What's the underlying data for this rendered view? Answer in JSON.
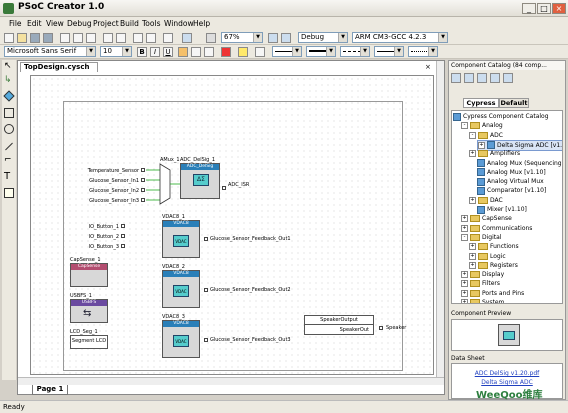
{
  "window": {
    "title": "PSoC Creator 1.0"
  },
  "menu": [
    "File",
    "Edit",
    "View",
    "Debug",
    "Project",
    "Build",
    "Tools",
    "Window",
    "Help"
  ],
  "toolbar": {
    "zoom": "67%",
    "configuration": "Debug",
    "compiler": "ARM CM3-GCC 4.2.3",
    "font": "Microsoft Sans Serif",
    "font_size": "10"
  },
  "document": {
    "tab": "TopDesign.cysch",
    "page_tab": "Page 1"
  },
  "schematic": {
    "adc_inputs": [
      "Temperature_Sensor",
      "Glucose_Sensor_In1",
      "Glucose_Sensor_In2",
      "Glucose_Sensor_In3"
    ],
    "amux_label": "AMux_1",
    "adc_label": "ADC_DelSig_1",
    "adc_type": "ADC_DelSig",
    "adc_isr": "ADC_ISR",
    "io_buttons": [
      "IO_Button_1",
      "IO_Button_2",
      "IO_Button_3"
    ],
    "vdac_labels": [
      "VDAC8_1",
      "VDAC8_2",
      "VDAC8_3"
    ],
    "vdac_type": "VDAC8",
    "vdac_outputs": [
      "Glucose_Sensor_Feedback_Out1",
      "Glucose_Sensor_Feedback_Out2",
      "Glucose_Sensor_Feedback_Out3"
    ],
    "capsense_label": "CapSense_1",
    "capsense_type": "CapSense",
    "usbfs_label": "USBFS_1",
    "usbfs_type": "USBFS",
    "lcd_label": "LCD_Seg_1",
    "lcd_type": "Segment LCD",
    "speaker_box": "SpeakerOutput",
    "speaker_out": "SpeakerOut",
    "speaker_pin": "Speaker"
  },
  "catalog": {
    "title": "Component Catalog (84 comp...",
    "tabs": [
      "Cypress",
      "Default"
    ],
    "tree": [
      {
        "level": 0,
        "kind": "root",
        "text": "Cypress Component Catalog"
      },
      {
        "level": 1,
        "kind": "folder",
        "exp": "-",
        "text": "Analog"
      },
      {
        "level": 2,
        "kind": "folder",
        "exp": "-",
        "text": "ADC"
      },
      {
        "level": 3,
        "kind": "comp",
        "exp": "+",
        "text": "Delta Sigma ADC [v1.20]",
        "selected": true
      },
      {
        "level": 2,
        "kind": "folder",
        "exp": "+",
        "text": "Amplifiers"
      },
      {
        "level": 3,
        "kind": "comp",
        "exp": "",
        "text": "Analog Mux (Sequencing)"
      },
      {
        "level": 3,
        "kind": "comp",
        "exp": "",
        "text": "Analog Mux [v1.10]"
      },
      {
        "level": 3,
        "kind": "comp",
        "exp": "",
        "text": "Analog Virtual Mux"
      },
      {
        "level": 3,
        "kind": "comp",
        "exp": "",
        "text": "Comparator [v1.10]"
      },
      {
        "level": 2,
        "kind": "folder",
        "exp": "+",
        "text": "DAC"
      },
      {
        "level": 3,
        "kind": "comp",
        "exp": "",
        "text": "Mixer [v1.10]"
      },
      {
        "level": 1,
        "kind": "folder",
        "exp": "+",
        "text": "CapSense"
      },
      {
        "level": 1,
        "kind": "folder",
        "exp": "+",
        "text": "Communications"
      },
      {
        "level": 1,
        "kind": "folder",
        "exp": "-",
        "text": "Digital"
      },
      {
        "level": 2,
        "kind": "folder",
        "exp": "+",
        "text": "Functions"
      },
      {
        "level": 2,
        "kind": "folder",
        "exp": "+",
        "text": "Logic"
      },
      {
        "level": 2,
        "kind": "folder",
        "exp": "+",
        "text": "Registers"
      },
      {
        "level": 1,
        "kind": "folder",
        "exp": "+",
        "text": "Display"
      },
      {
        "level": 1,
        "kind": "folder",
        "exp": "+",
        "text": "Filters"
      },
      {
        "level": 1,
        "kind": "folder",
        "exp": "+",
        "text": "Ports and Pins"
      },
      {
        "level": 1,
        "kind": "folder",
        "exp": "+",
        "text": "System"
      }
    ],
    "preview_title": "Component Preview",
    "datasheet_title": "Data Sheet",
    "datasheet_links": [
      "ADC DelSig v1.20.pdf",
      "Delta Sigma ADC"
    ]
  },
  "status": "Ready",
  "watermark": "WeeQoo维库"
}
